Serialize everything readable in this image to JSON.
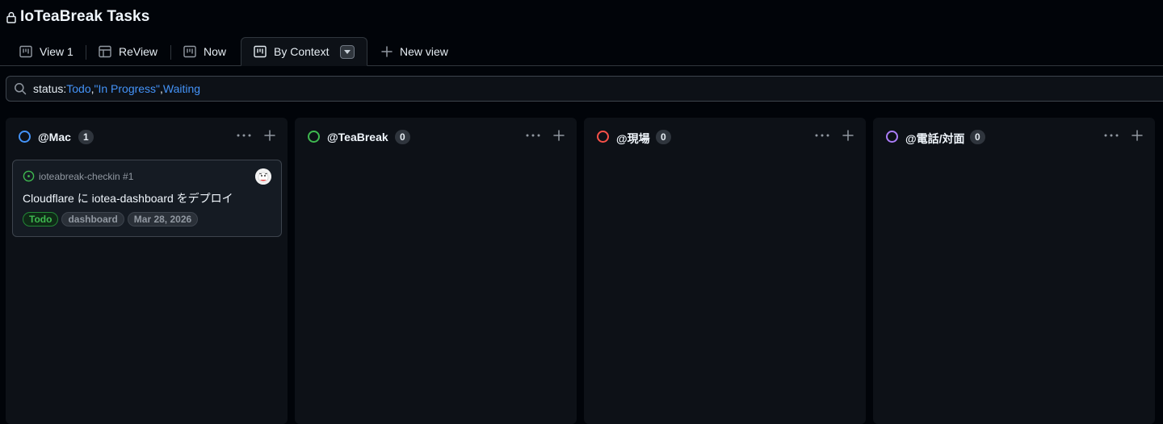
{
  "header": {
    "title": "IoTeaBreak Tasks",
    "lock_icon": "lock-icon"
  },
  "tabs": [
    {
      "label": "View 1",
      "icon": "board-icon"
    },
    {
      "label": "ReView",
      "icon": "table-icon"
    },
    {
      "label": "Now",
      "icon": "board-icon"
    },
    {
      "label": "By Context",
      "icon": "board-icon",
      "active": true
    },
    {
      "label": "New view",
      "icon": "plus-icon"
    }
  ],
  "filter": {
    "key": "status:",
    "values": [
      "Todo",
      "\"In Progress\"",
      "Waiting"
    ],
    "separator": ","
  },
  "columns": [
    {
      "name": "@Mac",
      "count": "1",
      "color": "#4493f8",
      "cards": [
        {
          "repo": "ioteabreak-checkin #1",
          "title": "Cloudflare に iotea-dashboard をデプロイ",
          "labels": [
            "Todo",
            "dashboard",
            "Mar 28, 2026"
          ]
        }
      ]
    },
    {
      "name": "@TeaBreak",
      "count": "0",
      "color": "#3fb950",
      "cards": []
    },
    {
      "name": "@現場",
      "count": "0",
      "color": "#f85149",
      "cards": []
    },
    {
      "name": "@電話/対面",
      "count": "0",
      "color": "#ab7df8",
      "cards": []
    }
  ],
  "colors": {
    "background": "#010409",
    "column": "#0d1117",
    "accent": "#4493f8",
    "success": "#3fb950"
  }
}
